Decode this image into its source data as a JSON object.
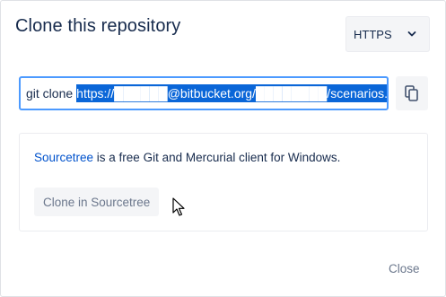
{
  "dialog": {
    "title": "Clone this repository",
    "protocol": {
      "selected": "HTTPS",
      "icon": "chevron-down-icon"
    },
    "clone_command": {
      "prefix": "git clone",
      "url": "https://██████@bitbucket.org/████████/scenarios.git"
    },
    "copy_icon": "copy-icon",
    "sourcetree": {
      "link_text": "Sourcetree",
      "description_rest": " is a free Git and Mercurial client for Windows.",
      "button_label": "Clone in Sourcetree"
    },
    "close_label": "Close"
  },
  "colors": {
    "accent": "#0052cc",
    "selection": "#0a66d8",
    "focus_border": "#4c9aff",
    "text": "#172b4d",
    "subtle_text": "#6b778c",
    "button_bg": "#f4f5f7"
  }
}
